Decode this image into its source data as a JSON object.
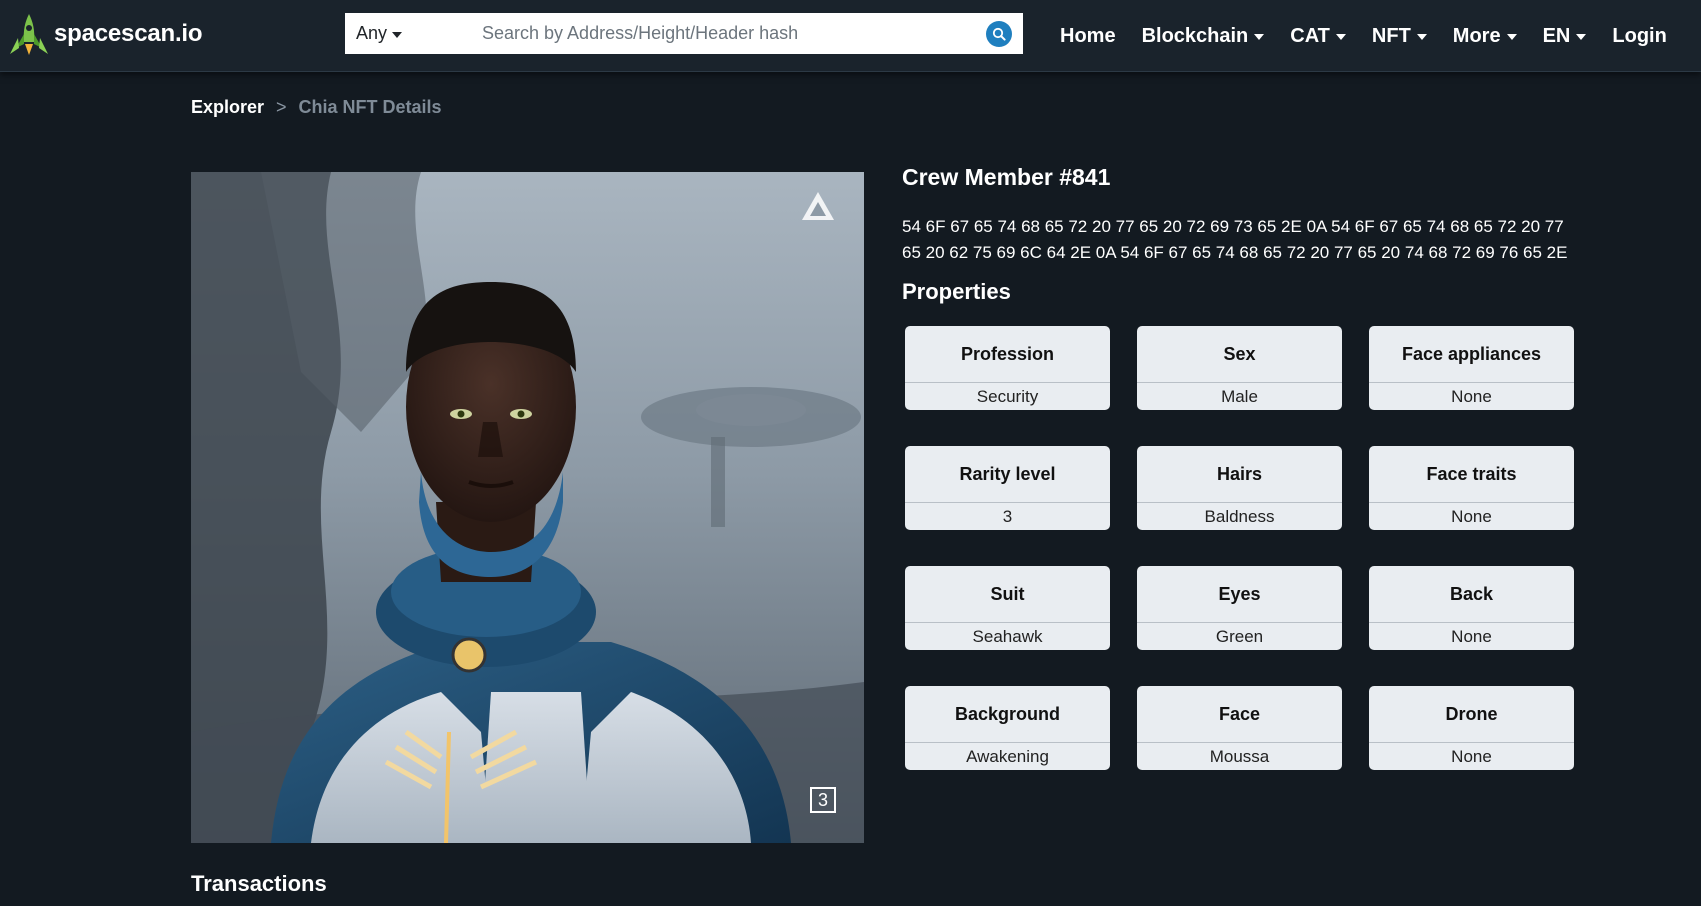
{
  "brand": {
    "name": "spacescan.io"
  },
  "search": {
    "filter_selected": "Any",
    "placeholder": "Search by Address/Height/Header hash",
    "value": ""
  },
  "nav": {
    "home": "Home",
    "blockchain": "Blockchain",
    "cat": "CAT",
    "nft": "NFT",
    "more": "More",
    "language": "EN",
    "login": "Login"
  },
  "breadcrumb": {
    "root": "Explorer",
    "separator": ">",
    "current": "Chia NFT Details"
  },
  "nft": {
    "title": "Crew Member #841",
    "description": "54 6F 67 65 74 68 65 72 20 77 65 20 72 69 73 65 2E 0A 54 6F 67 65 74 68 65 72 20 77 65 20 62 75 69 6C 64 2E 0A 54 6F 67 65 74 68 65 72 20 77 65 20 74 68 72 69 76 65 2E",
    "image_badge": "3"
  },
  "properties": {
    "title": "Properties",
    "items": [
      {
        "name": "Profession",
        "value": "Security"
      },
      {
        "name": "Sex",
        "value": "Male"
      },
      {
        "name": "Face appliances",
        "value": "None"
      },
      {
        "name": "Rarity level",
        "value": "3"
      },
      {
        "name": "Hairs",
        "value": "Baldness"
      },
      {
        "name": "Face traits",
        "value": "None"
      },
      {
        "name": "Suit",
        "value": "Seahawk"
      },
      {
        "name": "Eyes",
        "value": "Green"
      },
      {
        "name": "Back",
        "value": "None"
      },
      {
        "name": "Background",
        "value": "Awakening"
      },
      {
        "name": "Face",
        "value": "Moussa"
      },
      {
        "name": "Drone",
        "value": "None"
      }
    ]
  },
  "transactions": {
    "title": "Transactions"
  },
  "icons": {
    "logo": "spacescan-logo-icon",
    "search": "search-icon",
    "dropdown": "chevron-down-icon",
    "watermark": "triangle-logo-icon"
  },
  "colors": {
    "background": "#131a21",
    "navbar": "#1a232c",
    "card": "#e9edf1",
    "accent": "#1f7fbf",
    "logo_green": "#6fb338"
  }
}
